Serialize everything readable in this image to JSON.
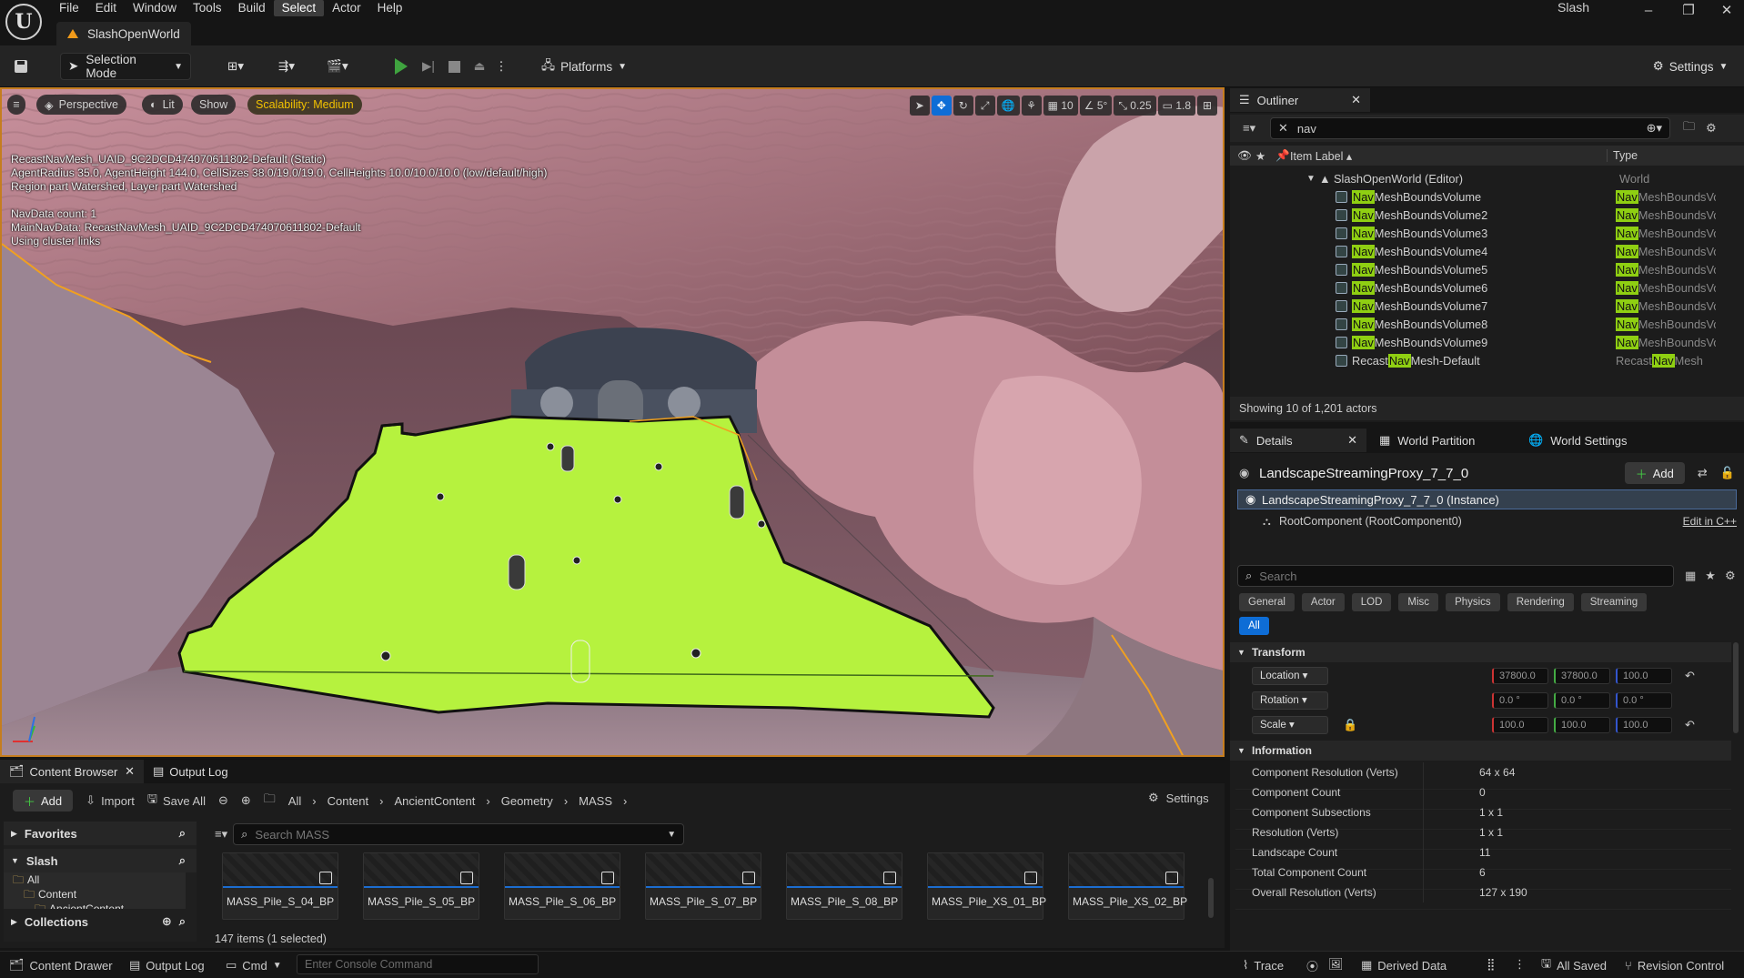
{
  "menu": [
    "File",
    "Edit",
    "Window",
    "Tools",
    "Build",
    "Select",
    "Actor",
    "Help"
  ],
  "active_menu": "Select",
  "level_tab": "SlashOpenWorld",
  "project_name": "Slash",
  "toolbar": {
    "selection_mode": "Selection Mode",
    "platforms": "Platforms",
    "settings": "Settings"
  },
  "viewport": {
    "perspective": "Perspective",
    "lit": "Lit",
    "show": "Show",
    "scalability": "Scalability: Medium",
    "grid": "10",
    "angle": "5°",
    "scale": "0.25",
    "camera_speed": "1.8",
    "nav_info": "RecastNavMesh_UAID_9C2DCD474070611802-Default (Static)\nAgentRadius 35.0, AgentHeight 144.0, CellSizes 38.0/19.0/19.0, CellHeights 10.0/10.0/10.0 (low/default/high)\nRegion part Watershed, Layer part Watershed\n\nNavData count: 1\nMainNavData: RecastNavMesh_UAID_9C2DCD474070611802-Default\nUsing cluster links"
  },
  "outliner": {
    "tab": "Outliner",
    "search_value": "nav",
    "col_label": "Item Label",
    "col_type": "Type",
    "world_row": {
      "label": "SlashOpenWorld (Editor)",
      "type": "World"
    },
    "rows": [
      {
        "pre": "",
        "hl": "Nav",
        "post": "MeshBoundsVolume",
        "tpre": "",
        "thl": "Nav",
        "tpost": "MeshBoundsVolum"
      },
      {
        "pre": "",
        "hl": "Nav",
        "post": "MeshBoundsVolume2",
        "tpre": "",
        "thl": "Nav",
        "tpost": "MeshBoundsVolum"
      },
      {
        "pre": "",
        "hl": "Nav",
        "post": "MeshBoundsVolume3",
        "tpre": "",
        "thl": "Nav",
        "tpost": "MeshBoundsVolum"
      },
      {
        "pre": "",
        "hl": "Nav",
        "post": "MeshBoundsVolume4",
        "tpre": "",
        "thl": "Nav",
        "tpost": "MeshBoundsVolum"
      },
      {
        "pre": "",
        "hl": "Nav",
        "post": "MeshBoundsVolume5",
        "tpre": "",
        "thl": "Nav",
        "tpost": "MeshBoundsVolum"
      },
      {
        "pre": "",
        "hl": "Nav",
        "post": "MeshBoundsVolume6",
        "tpre": "",
        "thl": "Nav",
        "tpost": "MeshBoundsVolum"
      },
      {
        "pre": "",
        "hl": "Nav",
        "post": "MeshBoundsVolume7",
        "tpre": "",
        "thl": "Nav",
        "tpost": "MeshBoundsVolum"
      },
      {
        "pre": "",
        "hl": "Nav",
        "post": "MeshBoundsVolume8",
        "tpre": "",
        "thl": "Nav",
        "tpost": "MeshBoundsVolum"
      },
      {
        "pre": "",
        "hl": "Nav",
        "post": "MeshBoundsVolume9",
        "tpre": "",
        "thl": "Nav",
        "tpost": "MeshBoundsVolum"
      },
      {
        "pre": "Recast",
        "hl": "Nav",
        "post": "Mesh-Default",
        "tpre": "Recast",
        "thl": "Nav",
        "tpost": "Mesh"
      }
    ],
    "footer": "Showing 10 of 1,201 actors"
  },
  "details": {
    "tabs": [
      "Details",
      "World Partition",
      "World Settings"
    ],
    "actor_name": "LandscapeStreamingProxy_7_7_0",
    "add": "Add",
    "instance_row": "LandscapeStreamingProxy_7_7_0 (Instance)",
    "root_row": "RootComponent (RootComponent0)",
    "edit_cpp": "Edit in C++",
    "search_placeholder": "Search",
    "categories": [
      "General",
      "Actor",
      "LOD",
      "Misc",
      "Physics",
      "Rendering",
      "Streaming"
    ],
    "all": "All",
    "transform_header": "Transform",
    "location": {
      "label": "Location",
      "x": "37800.0",
      "y": "37800.0",
      "z": "100.0"
    },
    "rotation": {
      "label": "Rotation",
      "x": "0.0 °",
      "y": "0.0 °",
      "z": "0.0 °"
    },
    "scale": {
      "label": "Scale",
      "x": "100.0",
      "y": "100.0",
      "z": "100.0"
    },
    "information_header": "Information",
    "info": [
      {
        "label": "Component Resolution (Verts)",
        "value": "64 x 64"
      },
      {
        "label": "Component Count",
        "value": "0"
      },
      {
        "label": "Component Subsections",
        "value": "1 x 1"
      },
      {
        "label": "Resolution (Verts)",
        "value": "1 x 1"
      },
      {
        "label": "Landscape Count",
        "value": "11"
      },
      {
        "label": "Total Component Count",
        "value": "6"
      },
      {
        "label": "Overall Resolution (Verts)",
        "value": "127 x 190"
      }
    ]
  },
  "content_browser": {
    "tab": "Content Browser",
    "output_log_tab": "Output Log",
    "add": "Add",
    "import": "Import",
    "save_all": "Save All",
    "breadcrumb": [
      "All",
      "Content",
      "AncientContent",
      "Geometry",
      "MASS"
    ],
    "settings": "Settings",
    "favorites": "Favorites",
    "slash": "Slash",
    "tree": [
      "All",
      "Content",
      "AncientContent"
    ],
    "collections": "Collections",
    "search_placeholder": "Search MASS",
    "assets": [
      "MASS_Pile_S_04_BP",
      "MASS_Pile_S_05_BP",
      "MASS_Pile_S_06_BP",
      "MASS_Pile_S_07_BP",
      "MASS_Pile_S_08_BP",
      "MASS_Pile_XS_01_BP",
      "MASS_Pile_XS_02_BP"
    ],
    "item_count": "147 items (1 selected)"
  },
  "statusbar": {
    "content_drawer": "Content Drawer",
    "output_log": "Output Log",
    "cmd": "Cmd",
    "console_placeholder": "Enter Console Command",
    "trace": "Trace",
    "derived_data": "Derived Data",
    "all_saved": "All Saved",
    "revision_control": "Revision Control"
  },
  "colors": {
    "accent": "#0e6dd6",
    "highlight": "#8fcf12",
    "navmesh": "#b6f23e",
    "viewport_border": "#c57d1f",
    "play": "#3fa33f"
  }
}
